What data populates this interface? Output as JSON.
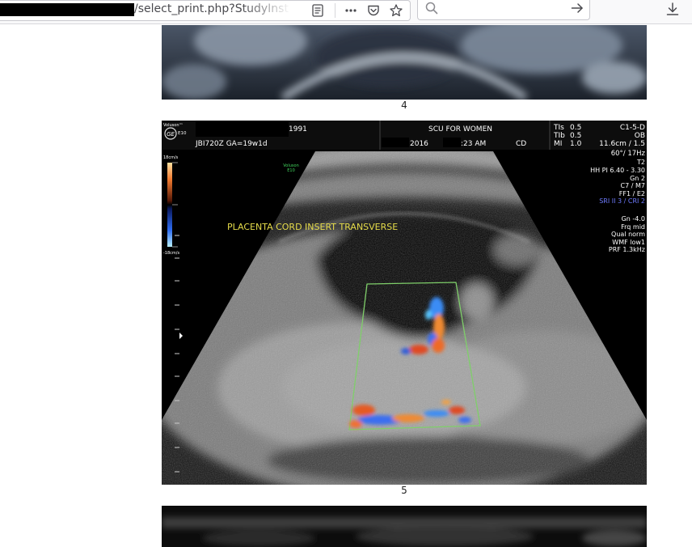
{
  "browser": {
    "url_visible": "/select_print.php?StudyInst"
  },
  "captions": {
    "image4": "4",
    "image5": "5"
  },
  "ultrasound": {
    "brand": "Voluson™",
    "model": "E10",
    "patient_year": "1991",
    "patient_id_ga": "JBI720Z  GA=19w1d",
    "facility": "SCU FOR WOMEN",
    "date_year": "2016",
    "time": ":23 AM",
    "operator": "CD",
    "tis_label": "TIs",
    "tis_value": "0.5",
    "tib_label": "TIb",
    "tib_value": "0.5",
    "mi_label": "MI",
    "mi_value": "1.0",
    "probe": "C1-5-D",
    "preset": "OB",
    "depth": "11.6cm / 1.5",
    "angle_rate": "60°/ 17Hz",
    "t_setting": "T2",
    "hh_pi": "HH PI 6.40 - 3.30",
    "gn": "Gn  2",
    "c_m": "C7 / M7",
    "ff_e": "FF1 / E2",
    "sri": "SRI II 3 / CRI 2",
    "color_gn": "Gn -4.0",
    "frq": "Frq mid",
    "qual": "Qual norm",
    "wmf": "WMF low1",
    "prf": "PRF  1.3kHz",
    "scale_top": "18cm/s",
    "scale_bottom": "-18cm/s",
    "small_logo_line1": "Voluson",
    "small_logo_line2": "E10",
    "annotation": "PLACENTA CORD INSERT TRANSVERSE",
    "colors": {
      "annotation": "#e6dc4a",
      "sri_text": "#6f7cff",
      "roi_box": "#7fcf6a",
      "small_logo": "#41d45c"
    }
  }
}
